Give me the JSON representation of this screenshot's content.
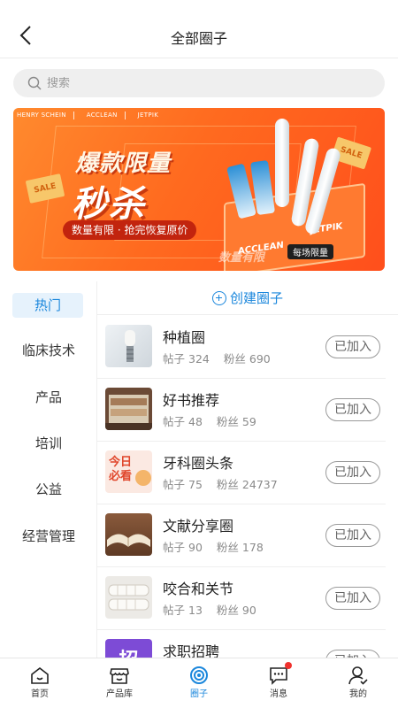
{
  "header": {
    "title": "全部圈子",
    "back_icon": "chevron-left-icon"
  },
  "search": {
    "placeholder": "搜索",
    "value": "",
    "icon": "search-icon"
  },
  "banner": {
    "brands": [
      "HENRY SCHEIN",
      "ACCLEAN",
      "JETPIK"
    ],
    "headline": "爆款限量",
    "main": "秒杀",
    "pill": "数量有限 · 抢完恢复原价",
    "sale_tag": "SALE",
    "limit_badge": "每场限量",
    "limit_stamp": "数量有限",
    "box_label_1": "ACCLEAN",
    "box_label_2": "JETPIK",
    "colors": {
      "bg": "#ff6a1f",
      "pill": "#c2240e"
    }
  },
  "categories": [
    {
      "label": "热门",
      "active": true
    },
    {
      "label": "临床技术",
      "active": false
    },
    {
      "label": "产品",
      "active": false
    },
    {
      "label": "培训",
      "active": false
    },
    {
      "label": "公益",
      "active": false
    },
    {
      "label": "经营管理",
      "active": false
    }
  ],
  "create_label": "创建圈子",
  "stat_labels": {
    "posts": "帖子",
    "fans": "粉丝"
  },
  "circles": [
    {
      "name": "种植圈",
      "posts": "324",
      "fans": "690",
      "join": "已加入",
      "thumb": "implant"
    },
    {
      "name": "好书推荐",
      "posts": "48",
      "fans": "59",
      "join": "已加入",
      "thumb": "books"
    },
    {
      "name": "牙科圈头条",
      "posts": "75",
      "fans": "24737",
      "join": "已加入",
      "thumb": "news",
      "thumb_text": "今日必看"
    },
    {
      "name": "文献分享圈",
      "posts": "90",
      "fans": "178",
      "join": "已加入",
      "thumb": "openbook"
    },
    {
      "name": "咬合和关节",
      "posts": "13",
      "fans": "90",
      "join": "已加入",
      "thumb": "teeth"
    },
    {
      "name": "求职招聘",
      "posts": "",
      "fans": "",
      "join": "已加入",
      "thumb": "jobs",
      "thumb_text": "招"
    }
  ],
  "tabs": [
    {
      "label": "首页",
      "icon": "home-icon",
      "active": false
    },
    {
      "label": "产品库",
      "icon": "store-icon",
      "active": false
    },
    {
      "label": "圈子",
      "icon": "circle-target-icon",
      "active": true
    },
    {
      "label": "消息",
      "icon": "message-icon",
      "active": false,
      "badge": true
    },
    {
      "label": "我的",
      "icon": "profile-icon",
      "active": false
    }
  ],
  "accent_color": "#1b87dc"
}
